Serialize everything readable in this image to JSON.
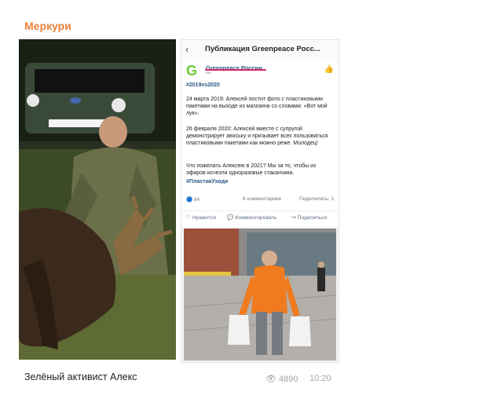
{
  "channel": {
    "name": "Меркури"
  },
  "vk_post": {
    "header_title": "Публикация Greenpeace Росс...",
    "org_name": "Greenpeace России",
    "hashtag": "#2019vs2020",
    "paragraph1": "24 марта 2019: Алексей постит фото с пластиковыми пакетами на выходе из магазина со словами: «Вот мой лук».",
    "paragraph2": "26 февраля 2020: Алексей вместе с супругой демонстрирует авоську и призывает всех пользоваться пластиковыми пакетами как можно реже. Молодец!",
    "paragraph3": "Что пожелать Алексею в 2021? Мы за то, чтобы из эфиров исчезли одноразовые стаканчики.",
    "hashtag2": "#ПластикУходи",
    "reactions": "84",
    "comments": "8 комментариев",
    "shares": "Поделились: 3",
    "like_label": "Нравится",
    "comment_label": "Комментировать",
    "share_label": "Поделиться"
  },
  "post_footer": {
    "caption": "Зелёный активист Алекс",
    "views": "4890",
    "time": "10:20"
  },
  "colors": {
    "channel_accent": "#e8833a",
    "vk_link": "#2a5885",
    "greenpeace": "#66cc33"
  }
}
